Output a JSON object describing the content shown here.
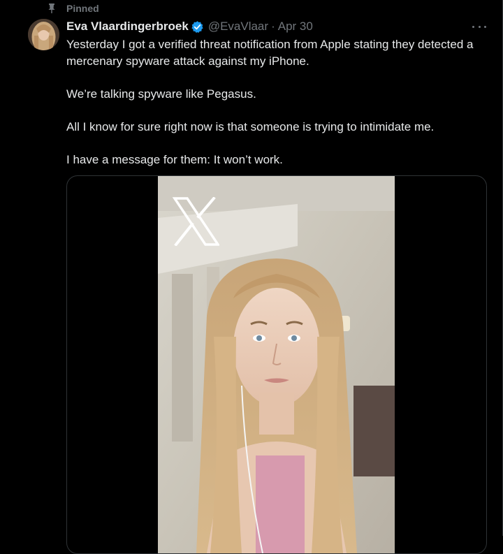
{
  "pinned": {
    "label": "Pinned",
    "icon": "pin-icon"
  },
  "author": {
    "display_name": "Eva Vlaardingerbroek",
    "verified_icon": "verified-badge-icon",
    "handle": "@EvaVlaar",
    "separator": "·",
    "date": "Apr 30"
  },
  "tweet": {
    "paragraphs": [
      "Yesterday I got a verified threat notification from Apple stating they detected a mercenary spyware attack against my iPhone.",
      "We’re talking spyware like Pegasus.",
      "All I know for sure right now is that someone is trying to intimidate me.",
      "I have a message for them: It won’t work."
    ]
  },
  "media": {
    "type": "video",
    "overlay_logo": "x-logo-icon"
  },
  "colors": {
    "background": "#000000",
    "text_primary": "#e7e9ea",
    "text_secondary": "#71767b",
    "verified_blue": "#1d9bf0",
    "border": "#2f3336"
  }
}
